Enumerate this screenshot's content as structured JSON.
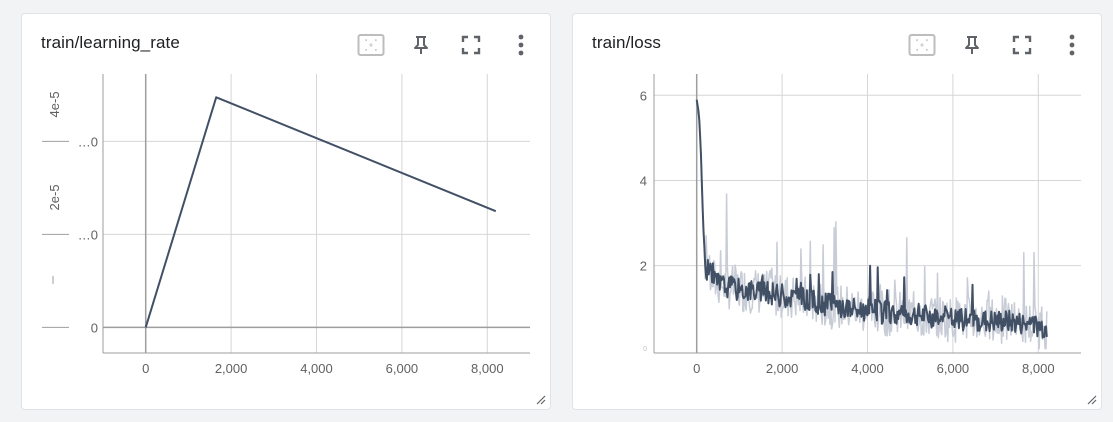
{
  "colors": {
    "line": "#425066",
    "raw_line": "#c7ccd6",
    "grid": "#d6d6d6",
    "axis": "#9e9e9e",
    "tick_text": "#616161",
    "icon": "#5f6368"
  },
  "toolbar_icons": [
    "fit-domain-icon",
    "pin-icon",
    "fullscreen-icon",
    "more-vert-icon"
  ],
  "cards": [
    {
      "title": "train/learning_rate",
      "chart_data": {
        "type": "line",
        "title": "train/learning_rate",
        "xlim": [
          -1000,
          9000
        ],
        "ylim": [
          -5.5e-06,
          5.45e-05
        ],
        "x_ticks": [
          0,
          2000,
          4000,
          6000,
          8000
        ],
        "x_tick_labels": [
          "0",
          "2,000",
          "4,000",
          "6,000",
          "8,000"
        ],
        "y_ticks": [
          0,
          2e-05,
          4e-05
        ],
        "y_tick_labels": [
          "0",
          "2e-5",
          "4e-5"
        ],
        "y_tick_values_truncated": [
          "…0",
          "…0"
        ],
        "series": [
          {
            "x": [
              0,
              1650,
              8200
            ],
            "y": [
              0,
              4.95e-05,
              2.5e-05
            ]
          }
        ]
      }
    },
    {
      "title": "train/loss",
      "chart_data": {
        "type": "line",
        "title": "train/loss",
        "xlim": [
          -1000,
          9000
        ],
        "ylim": [
          -0.05,
          6.5
        ],
        "x_ticks": [
          0,
          2000,
          4000,
          6000,
          8000
        ],
        "x_tick_labels": [
          "0",
          "2,000",
          "4,000",
          "6,000",
          "8,000"
        ],
        "y_ticks": [
          0,
          2,
          4,
          6
        ],
        "y_tick_labels": [
          "0",
          "2",
          "4",
          "6"
        ],
        "series": [
          {
            "x": [
              0,
              50,
              100,
              150,
              200,
              250,
              300,
              400,
              500,
              600,
              800,
              1000,
              1200,
              1400,
              1600,
              1800,
              2000,
              2400,
              2800,
              3200,
              3600,
              4000,
              4400,
              4800,
              5200,
              5600,
              6000,
              6400,
              6800,
              7200,
              7600,
              8000,
              8200
            ],
            "y": [
              5.9,
              5.6,
              4.6,
              3.0,
              2.05,
              1.9,
              1.75,
              1.65,
              1.6,
              1.55,
              1.5,
              1.45,
              1.45,
              1.4,
              1.35,
              1.35,
              1.3,
              1.25,
              1.15,
              1.05,
              1.0,
              0.95,
              0.9,
              0.85,
              0.85,
              0.8,
              0.75,
              0.75,
              0.7,
              0.7,
              0.65,
              0.6,
              0.55
            ]
          }
        ]
      }
    }
  ]
}
